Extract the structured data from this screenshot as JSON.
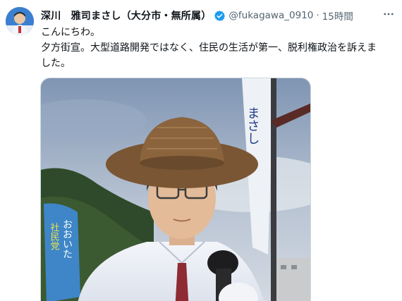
{
  "tweet": {
    "author": {
      "display_name": "深川　雅司まさし（大分市・無所属）",
      "handle": "@fukagawa_0910",
      "verified": true,
      "avatar_icon": "avatar-photo"
    },
    "separator": "·",
    "time": "15時間",
    "more_icon": "more-horizontal-icon",
    "text_lines": [
      "こんにちわ。",
      "夕方街宣。大型道路開発ではなく、住民の生活が第一、脱利権政治を訴えま",
      "した。"
    ],
    "photo": {
      "banner_left_text": "おおいた",
      "banner_left_small": "社民党",
      "banner_right_text": "まさし"
    }
  },
  "colors": {
    "text": "#0f1419",
    "secondary": "#536471",
    "verified_blue": "#1d9bf0",
    "border": "#cfd9de"
  }
}
